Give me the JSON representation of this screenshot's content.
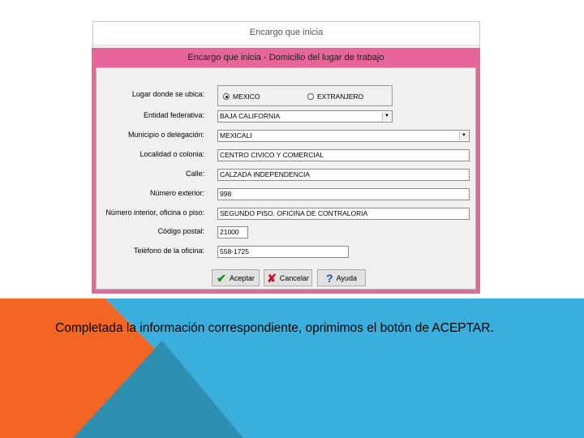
{
  "outer_window": {
    "title": "Encargo que inicia"
  },
  "dialog": {
    "title": "Encargo que inicia - Domicilio del lugar de trabajo",
    "fields": {
      "ubicacion_label": "Lugar donde se ubica:",
      "radio_mexico": "MEXICO",
      "radio_extranjero": "EXTRANJERO",
      "selected_location": "MEXICO",
      "entidad_label": "Entidad federativa:",
      "entidad_value": "BAJA CALIFORNIA",
      "municipio_label": "Municipio o delegación:",
      "municipio_value": "MEXICALI",
      "localidad_label": "Localidad o colonia:",
      "localidad_value": "CENTRO CIVICO Y COMERCIAL",
      "calle_label": "Calle:",
      "calle_value": "CALZADA INDEPENDENCIA",
      "num_ext_label": "Número exterior:",
      "num_ext_value": "998",
      "num_int_label": "Número interior, oficina o piso:",
      "num_int_value": "SEGUNDO PISO, OFICINA DE CONTRALORIA",
      "cp_label": "Código postal:",
      "cp_value": "21000",
      "telefono_label": "Teléfono de la oficina:",
      "telefono_value": "558-1725"
    },
    "buttons": {
      "accept": "Aceptar",
      "cancel": "Cancelar",
      "help": "Ayuda"
    }
  },
  "caption": {
    "text": "Completada la información correspondiente, oprimimos el botón de",
    "emphasis": "ACEPTAR",
    "end": "."
  },
  "colors": {
    "dialog_frame": "#e8659a",
    "shape_orange": "#f26522",
    "shape_blue": "#3aaedc",
    "shape_teal": "#2f8fb0"
  },
  "icons": {
    "accept": "check-icon",
    "cancel": "x-icon",
    "help": "question-icon"
  }
}
